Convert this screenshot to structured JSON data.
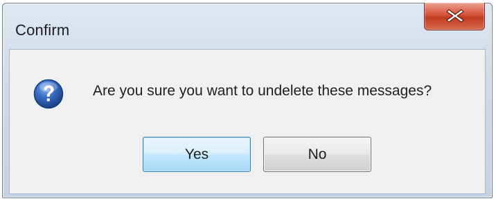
{
  "dialog": {
    "title": "Confirm",
    "message": "Are you sure you want to undelete these messages?",
    "icon": "question-icon",
    "close_icon": "close-icon",
    "buttons": {
      "yes_label": "Yes",
      "no_label": "No"
    },
    "colors": {
      "close_button": "#c9452b",
      "question_icon": "#2d5fb0",
      "default_button_border": "#3c7fb1"
    }
  }
}
